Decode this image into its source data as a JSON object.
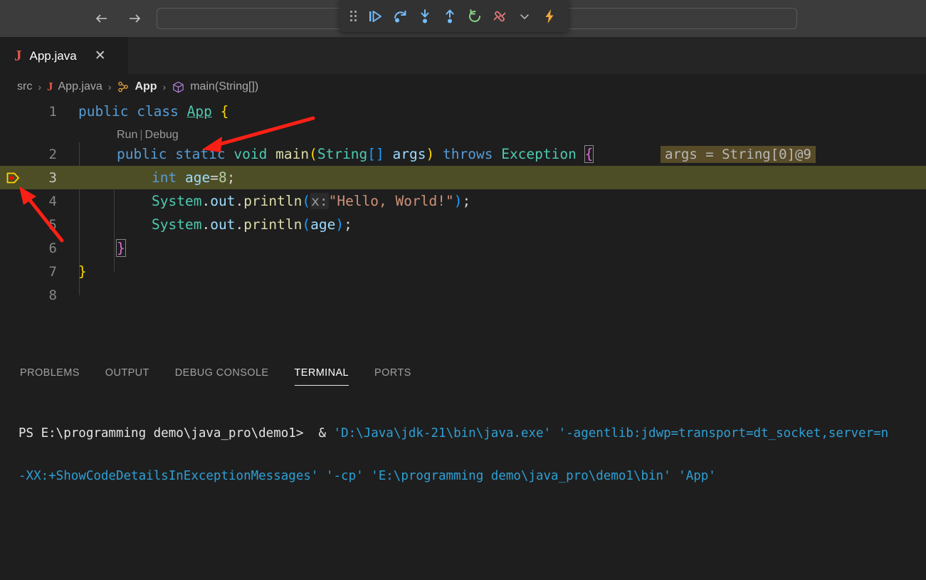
{
  "topbar": {
    "back_icon": "arrow-left-icon",
    "forward_icon": "arrow-right-icon",
    "command_placeholder": ""
  },
  "debug_toolbar": {
    "handle_icon": "drag-handle-icon",
    "buttons": [
      {
        "name": "continue",
        "icon": "continue-icon",
        "title": "Continue",
        "color": "#75beff"
      },
      {
        "name": "step-over",
        "icon": "step-over-icon",
        "title": "Step Over",
        "color": "#75beff"
      },
      {
        "name": "step-into",
        "icon": "step-into-icon",
        "title": "Step Into",
        "color": "#75beff"
      },
      {
        "name": "step-out",
        "icon": "step-out-icon",
        "title": "Step Out",
        "color": "#75beff"
      },
      {
        "name": "restart",
        "icon": "restart-icon",
        "title": "Restart",
        "color": "#89d185"
      },
      {
        "name": "disconnect",
        "icon": "disconnect-icon",
        "title": "Disconnect",
        "color": "#e87979"
      },
      {
        "name": "more",
        "icon": "chevron-down-icon",
        "title": "More",
        "color": "#c5c5c5"
      },
      {
        "name": "hot-reload",
        "icon": "lightning-bolt-icon",
        "title": "Hot Code Replace",
        "color": "#f2a93b"
      }
    ]
  },
  "tab": {
    "icon": "java-file-icon",
    "icon_glyph": "J",
    "label": "App.java",
    "close_glyph": "✕"
  },
  "breadcrumb": {
    "items": [
      {
        "label": "src",
        "icon": null,
        "strong": false
      },
      {
        "label": "App.java",
        "icon": "java-file-icon",
        "icon_glyph": "J",
        "strong": false
      },
      {
        "label": "App",
        "icon": "class-symbol-icon",
        "strong": true
      },
      {
        "label": "main(String[])",
        "icon": "method-symbol-icon",
        "strong": false
      }
    ],
    "separator": "›"
  },
  "editor": {
    "line_numbers": [
      "1",
      "2",
      "3",
      "4",
      "5",
      "6",
      "7",
      "8"
    ],
    "active_line": "3",
    "codelens": {
      "run": "Run",
      "separator": "|",
      "debug": "Debug"
    },
    "breakpoint": {
      "name": "breakpoint-execution-pointer",
      "line": "3"
    },
    "inline_debug_value": "args = String[0]@9",
    "lines": {
      "l1": "public class App {",
      "l2": "public static void main(String[] args) throws Exception {",
      "l3": "int age=8;",
      "l4": "System.out.println(x:\"Hello, World!\");",
      "l5": "System.out.println(age);",
      "l6": "}",
      "l7": "}",
      "l8": ""
    },
    "tokens": {
      "public": "public",
      "class": "class",
      "appname": "App",
      "brace_open_yellow": "{",
      "static": "static",
      "void": "void",
      "main": "main",
      "paren_open": "(",
      "String": "String",
      "brackets": "[]",
      "args": "args",
      "paren_close": ")",
      "throws": "throws",
      "Exception": "Exception",
      "brace_open_pink": "{",
      "int": "int",
      "age": "age",
      "eq": "=",
      "eight": "8",
      "semi": ";",
      "System": "System",
      "dot": ".",
      "out": "out",
      "println": "println",
      "xhint": "x:",
      "hello": "\"Hello, World!\"",
      "agevar": "age",
      "brace_close_pink": "}",
      "brace_close_yellow": "}"
    }
  },
  "panel": {
    "tabs": [
      {
        "label": "PROBLEMS",
        "active": false
      },
      {
        "label": "OUTPUT",
        "active": false
      },
      {
        "label": "DEBUG CONSOLE",
        "active": false
      },
      {
        "label": "TERMINAL",
        "active": true
      },
      {
        "label": "PORTS",
        "active": false
      }
    ],
    "terminal": {
      "prompt": "PS E:\\programming demo\\java_pro\\demo1>",
      "line1_mid": "  & ",
      "line1_blue": "'D:\\Java\\jdk-21\\bin\\java.exe' '-agentlib:jdwp=transport=dt_socket,server=n",
      "line2_blue": "-XX:+ShowCodeDetailsInExceptionMessages' '-cp' 'E:\\programming demo\\java_pro\\demo1\\bin' 'App'"
    }
  },
  "colors": {
    "topbar_bg": "#3c3c3c",
    "tabbar_bg": "#252526",
    "editor_bg": "#1e1e1e",
    "active_line_bg": "#4e4e26",
    "inline_value_bg": "#574b28",
    "annotation_arrow": "#fb2016"
  }
}
